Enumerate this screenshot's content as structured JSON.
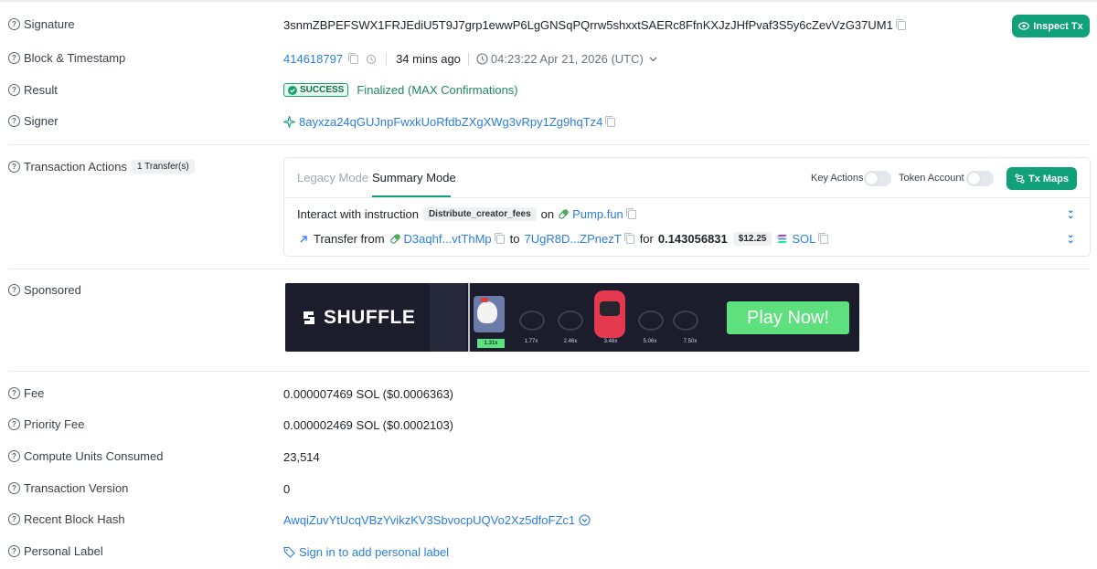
{
  "rows": {
    "signature": {
      "label": "Signature",
      "value": "3snmZBPEFSWX1FRJEdiU5T9J7grp1ewwP6LgGNSqPQrrw5shxxtSAERc8FfnKXJzJHfPvaf3S5y6cZevVzG37UM1"
    },
    "block": {
      "label": "Block & Timestamp",
      "block": "414618797",
      "ago": "34 mins ago",
      "timestamp": "04:23:22 Apr 21, 2026 (UTC)"
    },
    "result": {
      "label": "Result",
      "status": "SUCCESS",
      "confirmation": "Finalized (MAX Confirmations)"
    },
    "signer": {
      "label": "Signer",
      "value": "8ayxza24qGUJnpFwxkUoRfdbZXgXWg3vRpy1Zg9hqTz4"
    },
    "actions": {
      "label": "Transaction Actions",
      "badge": "1 Transfer(s)"
    },
    "sponsored": {
      "label": "Sponsored"
    },
    "fee": {
      "label": "Fee",
      "value": "0.000007469 SOL ($0.0006363)"
    },
    "priority_fee": {
      "label": "Priority Fee",
      "value": "0.000002469 SOL ($0.0002103)"
    },
    "compute": {
      "label": "Compute Units Consumed",
      "value": "23,514"
    },
    "version": {
      "label": "Transaction Version",
      "value": "0"
    },
    "recent_hash": {
      "label": "Recent Block Hash",
      "value": "AwqiZuvYtUcqVBzYvikzKV3SbvocpUQVo2Xz5dfoFZc1"
    },
    "personal_label": {
      "label": "Personal Label",
      "link": "Sign in to add personal label"
    }
  },
  "inspect_button": "Inspect Tx",
  "actions_card": {
    "tabs": [
      "Legacy Mode",
      "Summary Mode"
    ],
    "active_tab": "Summary Mode",
    "key_actions": "Key Actions",
    "token_account": "Token Account",
    "tx_maps": "Tx Maps",
    "line1": {
      "prefix": "Interact with instruction",
      "instruction": "Distribute_creator_fees",
      "on": "on",
      "program": "Pump.fun"
    },
    "line2": {
      "prefix": "Transfer from",
      "from": "D3aqhf...vtThMp",
      "to_word": "to",
      "to": "7UgR8D...ZPnezT",
      "for_word": "for",
      "amount": "0.143056831",
      "usd": "$12.25",
      "token": "SOL"
    }
  },
  "ad": {
    "brand": "SHUFFLE",
    "cta": "Play Now!",
    "multipliers": [
      "1.31x",
      "1.77x",
      "2.46x",
      "3.48x",
      "5.06x",
      "7.50x"
    ]
  },
  "colors": {
    "accent": "#11a178",
    "link": "#2a7de1",
    "success": "#19a171"
  },
  "icons": [
    "help-icon",
    "copy-icon",
    "history-icon",
    "clock-icon",
    "chevron-down-icon",
    "check-icon",
    "sparkle-icon",
    "eye-icon",
    "map-icon",
    "pill-icon",
    "arrow-up-right-icon",
    "solana-icon",
    "tag-icon",
    "double-chevron-icon"
  ]
}
